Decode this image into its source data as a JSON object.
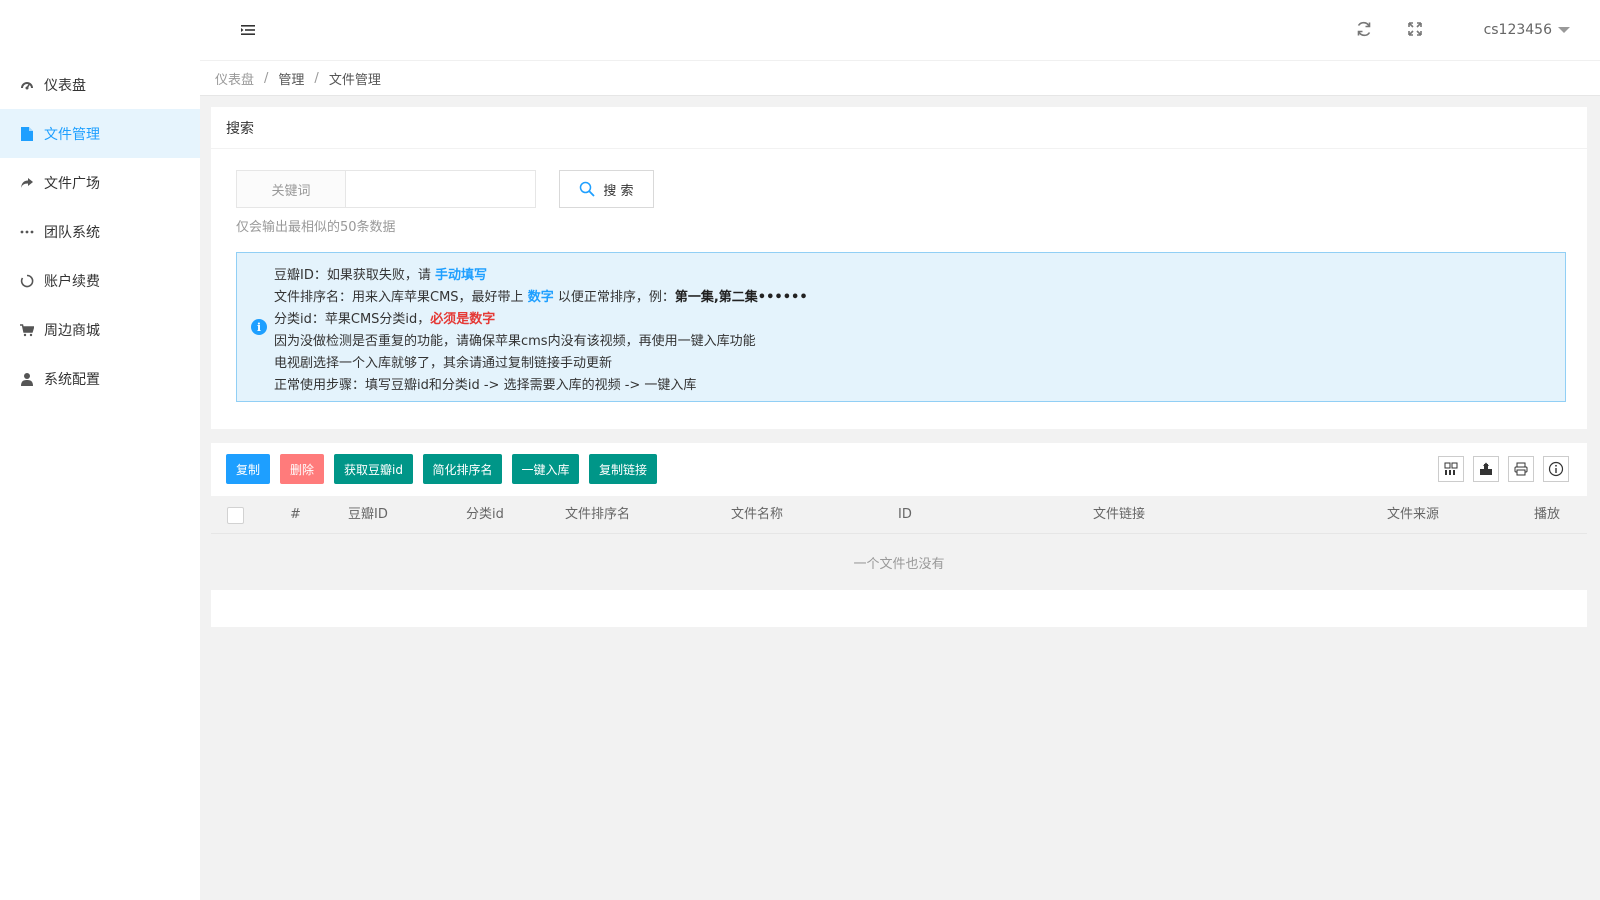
{
  "header": {
    "user": "cs123456"
  },
  "sidebar": {
    "items": [
      {
        "label": "仪表盘",
        "icon": "dashboard-icon"
      },
      {
        "label": "文件管理",
        "icon": "file-icon",
        "active": true
      },
      {
        "label": "文件广场",
        "icon": "share-icon"
      },
      {
        "label": "团队系统",
        "icon": "ellipsis-icon"
      },
      {
        "label": "账户续费",
        "icon": "circle-icon"
      },
      {
        "label": "周边商城",
        "icon": "cart-icon"
      },
      {
        "label": "系统配置",
        "icon": "user-icon"
      }
    ]
  },
  "breadcrumb": {
    "items": [
      "仪表盘",
      "管理",
      "文件管理"
    ]
  },
  "search": {
    "title": "搜索",
    "label": "关键词",
    "value": "",
    "button": "搜 索",
    "hint": "仅会输出最相似的50条数据"
  },
  "notice": {
    "line1": {
      "a": "豆瓣ID：如果获取失败，请 ",
      "b": "手动填写"
    },
    "line2": {
      "a": "文件排序名：用来入库苹果CMS，最好带上 ",
      "b": "数字",
      "c": " 以便正常排序，例：",
      "d": "第一集,第二集••••••"
    },
    "line3": {
      "a": "分类id：苹果CMS分类id，",
      "b": "必须是数字"
    },
    "line4": "因为没做检测是否重复的功能，请确保苹果cms内没有该视频，再使用一键入库功能",
    "line5": "电视剧选择一个入库就够了，其余请通过复制链接手动更新",
    "line6": "正常使用步骤：填写豆瓣id和分类id -> 选择需要入库的视频 -> 一键入库"
  },
  "toolbar": {
    "copy": "复制",
    "delete": "删除",
    "get_douban": "获取豆瓣id",
    "simplify": "简化排序名",
    "import": "一键入库",
    "copy_link": "复制链接"
  },
  "colors": {
    "accent": "#1e9fff",
    "danger": "#ff5722",
    "primary": "#009688"
  },
  "table": {
    "columns": [
      "#",
      "豆瓣ID",
      "分类id",
      "文件排序名",
      "文件名称",
      "ID",
      "文件链接",
      "文件来源",
      "播放"
    ],
    "empty": "一个文件也没有"
  }
}
